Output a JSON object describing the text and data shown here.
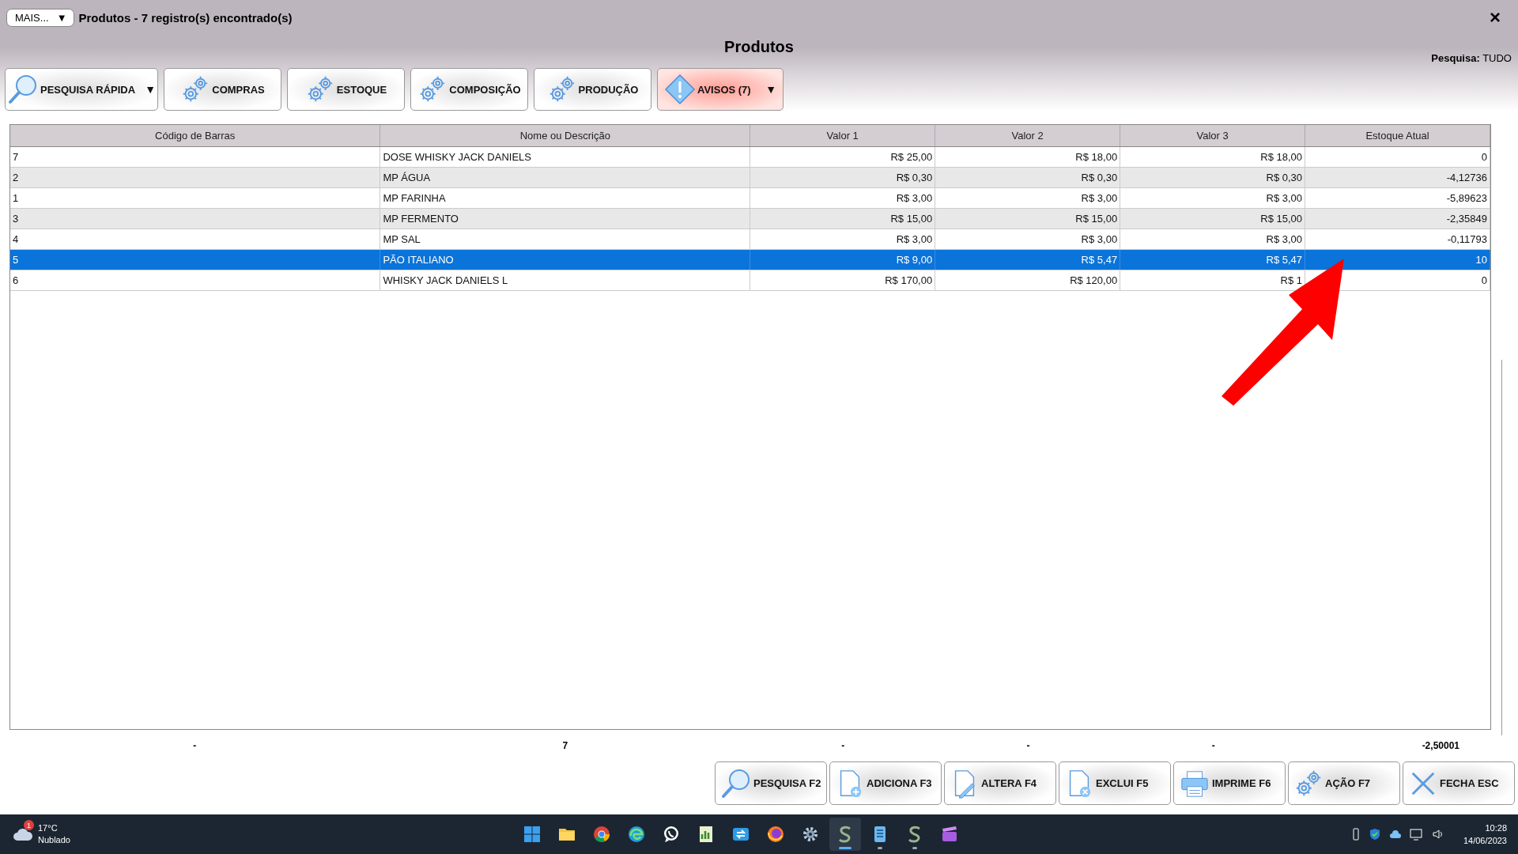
{
  "window": {
    "menu_button": "MAIS...",
    "menu_caret": "▼",
    "title": "Produtos - 7 registro(s) encontrado(s)",
    "close": "×"
  },
  "heading": "Produtos",
  "search_scope": {
    "label": "Pesquisa:",
    "value": "TUDO"
  },
  "toolbar": [
    {
      "label": "PESQUISA RÁPIDA",
      "kind": "search",
      "caret": "▼"
    },
    {
      "label": "COMPRAS",
      "kind": "gears"
    },
    {
      "label": "ESTOQUE",
      "kind": "gears"
    },
    {
      "label": "COMPOSIÇÃO",
      "kind": "gears"
    },
    {
      "label": "PRODUÇÃO",
      "kind": "gears"
    },
    {
      "label": "AVISOS (7)",
      "kind": "warning",
      "caret": "▼"
    }
  ],
  "table": {
    "columns": [
      "Código de Barras",
      "Nome ou Descrição",
      "Valor 1",
      "Valor 2",
      "Valor 3",
      "Estoque Atual"
    ],
    "rows": [
      {
        "cells": [
          "7",
          "DOSE WHISKY JACK DANIELS",
          "R$ 25,00",
          "R$ 18,00",
          "R$ 18,00",
          "0"
        ],
        "selected": false
      },
      {
        "cells": [
          "2",
          "MP ÁGUA",
          "R$ 0,30",
          "R$ 0,30",
          "R$ 0,30",
          "-4,12736"
        ],
        "selected": false
      },
      {
        "cells": [
          "1",
          "MP FARINHA",
          "R$ 3,00",
          "R$ 3,00",
          "R$ 3,00",
          "-5,89623"
        ],
        "selected": false
      },
      {
        "cells": [
          "3",
          "MP FERMENTO",
          "R$ 15,00",
          "R$ 15,00",
          "R$ 15,00",
          "-2,35849"
        ],
        "selected": false
      },
      {
        "cells": [
          "4",
          "MP SAL",
          "R$ 3,00",
          "R$ 3,00",
          "R$ 3,00",
          "-0,11793"
        ],
        "selected": false
      },
      {
        "cells": [
          "5",
          "PÃO ITALIANO",
          "R$ 9,00",
          "R$ 5,47",
          "R$ 5,47",
          "10"
        ],
        "selected": true
      },
      {
        "cells": [
          "6",
          "WHISKY JACK DANIELS L",
          "R$ 170,00",
          "R$ 120,00",
          "R$ 1",
          "0"
        ],
        "selected": false
      }
    ],
    "totals": [
      "-",
      "7",
      "-",
      "-",
      "-",
      "-2,50001"
    ]
  },
  "actions": [
    {
      "label": "PESQUISA F2",
      "kind": "search"
    },
    {
      "label": "ADICIONA F3",
      "kind": "add"
    },
    {
      "label": "ALTERA F4",
      "kind": "edit"
    },
    {
      "label": "EXCLUI F5",
      "kind": "delete"
    },
    {
      "label": "IMPRIME F6",
      "kind": "print"
    },
    {
      "label": "AÇÃO F7",
      "kind": "gears"
    },
    {
      "label": "FECHA ESC",
      "kind": "close"
    }
  ],
  "taskbar": {
    "weather": {
      "badge": "1",
      "temperature": "17°C",
      "condition": "Nublado"
    },
    "apps": [
      {
        "kind": "start",
        "running": false,
        "selected": false
      },
      {
        "kind": "folder",
        "running": false,
        "selected": false
      },
      {
        "kind": "chrome",
        "running": false,
        "selected": false
      },
      {
        "kind": "edge",
        "running": false,
        "selected": false
      },
      {
        "kind": "whatsapp",
        "running": false,
        "selected": false
      },
      {
        "kind": "sheet",
        "running": false,
        "selected": false
      },
      {
        "kind": "sync",
        "running": false,
        "selected": false
      },
      {
        "kind": "firefox",
        "running": false,
        "selected": false
      },
      {
        "kind": "gear",
        "running": false,
        "selected": false
      },
      {
        "kind": "s-app",
        "running": true,
        "selected": true
      },
      {
        "kind": "notepad",
        "running": true,
        "selected": false
      },
      {
        "kind": "s-app",
        "running": true,
        "selected": false
      },
      {
        "kind": "clapper",
        "running": false,
        "selected": false
      }
    ],
    "time": "10:28",
    "date": "14/06/2023"
  }
}
